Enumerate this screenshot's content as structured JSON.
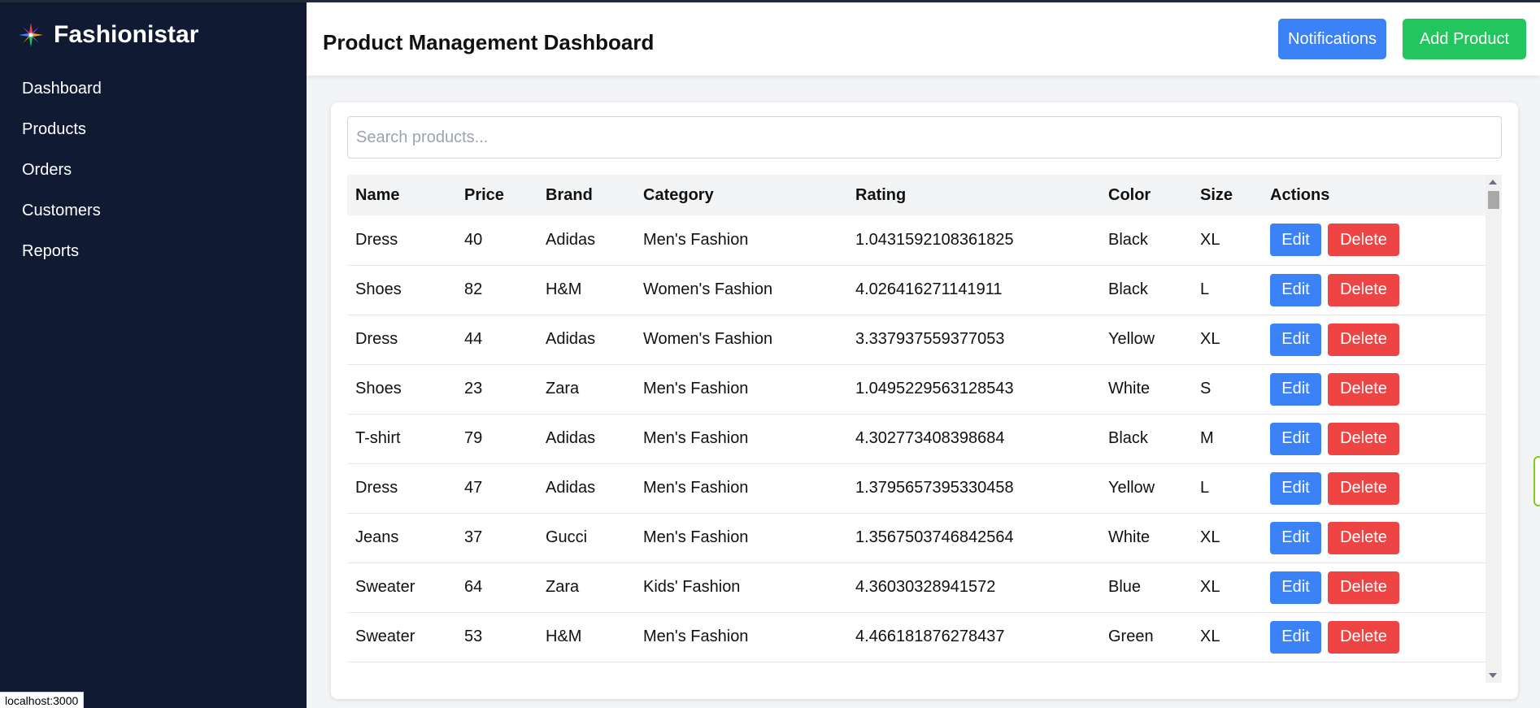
{
  "brand": {
    "name": "Fashionistar",
    "logo_icon": "star-burst-icon"
  },
  "sidebar": {
    "items": [
      {
        "label": "Dashboard"
      },
      {
        "label": "Products"
      },
      {
        "label": "Orders"
      },
      {
        "label": "Customers"
      },
      {
        "label": "Reports"
      }
    ]
  },
  "status_bar": {
    "url": "localhost:3000"
  },
  "header": {
    "title": "Product Management Dashboard",
    "notifications_label": "Notifications",
    "add_product_label": "Add Product"
  },
  "search": {
    "placeholder": "Search products...",
    "value": ""
  },
  "table": {
    "columns": [
      "Name",
      "Price",
      "Brand",
      "Category",
      "Rating",
      "Color",
      "Size",
      "Actions"
    ],
    "edit_label": "Edit",
    "delete_label": "Delete",
    "rows": [
      [
        "Dress",
        "40",
        "Adidas",
        "Men's Fashion",
        "1.0431592108361825",
        "Black",
        "XL"
      ],
      [
        "Shoes",
        "82",
        "H&M",
        "Women's Fashion",
        "4.026416271141911",
        "Black",
        "L"
      ],
      [
        "Dress",
        "44",
        "Adidas",
        "Women's Fashion",
        "3.337937559377053",
        "Yellow",
        "XL"
      ],
      [
        "Shoes",
        "23",
        "Zara",
        "Men's Fashion",
        "1.0495229563128543",
        "White",
        "S"
      ],
      [
        "T-shirt",
        "79",
        "Adidas",
        "Men's Fashion",
        "4.302773408398684",
        "Black",
        "M"
      ],
      [
        "Dress",
        "47",
        "Adidas",
        "Men's Fashion",
        "1.3795657395330458",
        "Yellow",
        "L"
      ],
      [
        "Jeans",
        "37",
        "Gucci",
        "Men's Fashion",
        "1.3567503746842564",
        "White",
        "XL"
      ],
      [
        "Sweater",
        "64",
        "Zara",
        "Kids' Fashion",
        "4.36030328941572",
        "Blue",
        "XL"
      ],
      [
        "Sweater",
        "53",
        "H&M",
        "Men's Fashion",
        "4.466181876278437",
        "Green",
        "XL"
      ]
    ]
  },
  "colors": {
    "sidebar_bg": "#111a33",
    "primary": "#3b82f6",
    "success": "#22c55e",
    "danger": "#ef4444"
  }
}
